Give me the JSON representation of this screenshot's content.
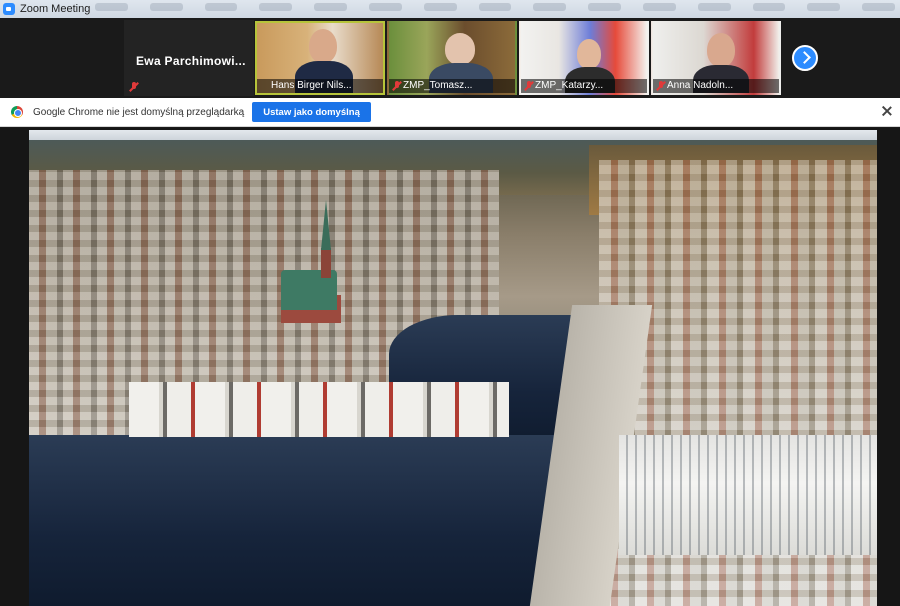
{
  "window": {
    "title": "Zoom Meeting"
  },
  "self_view": {
    "name": "Ewa  Parchimowi..."
  },
  "participants": [
    {
      "name": "Hans Birger Nils...",
      "active": true
    },
    {
      "name": "ZMP_Tomasz...",
      "active": false
    },
    {
      "name": "ZMP_Katarzy...",
      "active": false
    },
    {
      "name": "Anna Nadoln...",
      "active": false
    }
  ],
  "infobar": {
    "message": "Google Chrome nie jest domyślną przeglądarką",
    "button_label": "Ustaw jako domyślną"
  },
  "colors": {
    "zoom_blue": "#2d8cff",
    "chrome_button": "#1a73e8",
    "active_speaker": "#b6c43a",
    "mic_muted": "#e03a3a"
  },
  "icons": {
    "app": "zoom-icon",
    "muted": "mic-off-icon",
    "next": "chevron-right-icon",
    "browser": "chrome-icon",
    "close": "close-icon"
  }
}
